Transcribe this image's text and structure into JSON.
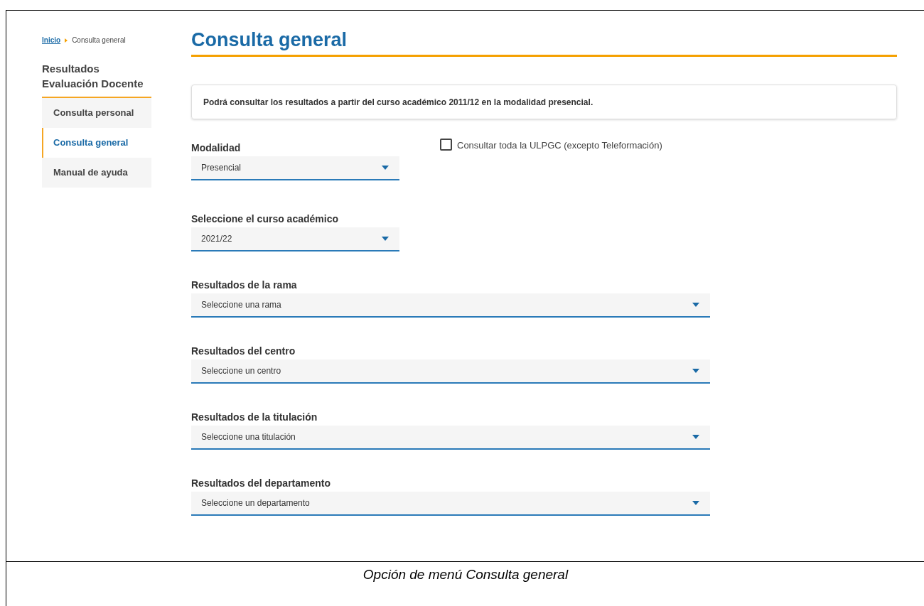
{
  "breadcrumb": {
    "link": "Inicio",
    "current": "Consulta general"
  },
  "sidebar": {
    "title": "Resultados Evaluación Docente",
    "items": [
      {
        "label": "Consulta personal",
        "selected": false
      },
      {
        "label": "Consulta general",
        "selected": true
      },
      {
        "label": "Manual de ayuda",
        "selected": false
      }
    ]
  },
  "page_title": "Consulta general",
  "notice": "Podrá consultar los resultados a partir del curso académico 2011/12 en la modalidad presencial.",
  "checkbox": {
    "label": "Consultar toda la ULPGC (excepto Teleformación)",
    "checked": false
  },
  "fields": [
    {
      "label": "Modalidad",
      "value": "Presencial",
      "kind": "narrow"
    },
    {
      "label": "Seleccione el curso académico",
      "value": "2021/22",
      "kind": "narrow"
    },
    {
      "label": "Resultados de la rama",
      "value": "Seleccione una rama",
      "kind": "wide"
    },
    {
      "label": "Resultados del centro",
      "value": "Seleccione un centro",
      "kind": "wide"
    },
    {
      "label": "Resultados de la titulación",
      "value": "Seleccione una titulación",
      "kind": "wide"
    },
    {
      "label": "Resultados del departamento",
      "value": "Seleccione un departamento",
      "kind": "wide"
    }
  ],
  "caption": "Opción de menú Consulta general"
}
